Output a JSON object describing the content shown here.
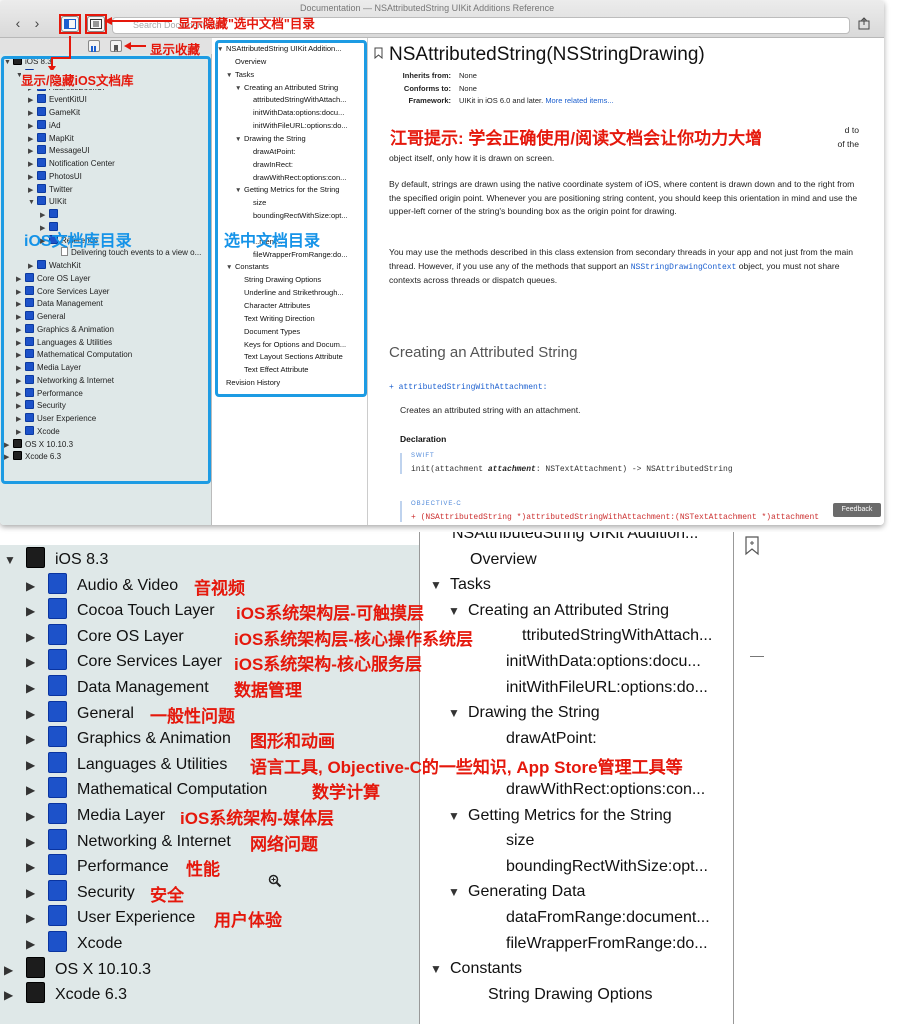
{
  "window": {
    "title": "Documentation — NSAttributedString UIKit Additions Reference",
    "search_placeholder": "Search Documentation"
  },
  "library": {
    "rows": [
      {
        "label": "iOS 8.3",
        "depth": 0,
        "open": true,
        "icon": "dark"
      },
      {
        "label": "Cocoa Touch Layer",
        "depth": 1,
        "open": true,
        "icon": "blue"
      },
      {
        "label": "AddressBookUI",
        "depth": 2,
        "open": false,
        "icon": "blue"
      },
      {
        "label": "EventKitUI",
        "depth": 2,
        "open": false,
        "icon": "blue"
      },
      {
        "label": "GameKit",
        "depth": 2,
        "open": false,
        "icon": "blue"
      },
      {
        "label": "iAd",
        "depth": 2,
        "open": false,
        "icon": "blue"
      },
      {
        "label": "MapKit",
        "depth": 2,
        "open": false,
        "icon": "blue"
      },
      {
        "label": "MessageUI",
        "depth": 2,
        "open": false,
        "icon": "blue"
      },
      {
        "label": "Notification Center",
        "depth": 2,
        "open": false,
        "icon": "blue"
      },
      {
        "label": "PhotosUI",
        "depth": 2,
        "open": false,
        "icon": "blue"
      },
      {
        "label": "Twitter",
        "depth": 2,
        "open": false,
        "icon": "blue"
      },
      {
        "label": "UIKit",
        "depth": 2,
        "open": true,
        "icon": "blue"
      },
      {
        "label": "",
        "depth": 3,
        "open": false,
        "icon": "blue"
      },
      {
        "label": "",
        "depth": 3,
        "open": false,
        "icon": "blue"
      },
      {
        "label": "Reference",
        "depth": 3,
        "open": false,
        "icon": "blue"
      },
      {
        "label": "Delivering touch events to a view o...",
        "depth": 4,
        "open": false,
        "icon": "doc"
      },
      {
        "label": "WatchKit",
        "depth": 2,
        "open": false,
        "icon": "blue"
      },
      {
        "label": "Core OS Layer",
        "depth": 1,
        "open": false,
        "icon": "blue"
      },
      {
        "label": "Core Services Layer",
        "depth": 1,
        "open": false,
        "icon": "blue"
      },
      {
        "label": "Data Management",
        "depth": 1,
        "open": false,
        "icon": "blue"
      },
      {
        "label": "General",
        "depth": 1,
        "open": false,
        "icon": "blue"
      },
      {
        "label": "Graphics & Animation",
        "depth": 1,
        "open": false,
        "icon": "blue"
      },
      {
        "label": "Languages & Utilities",
        "depth": 1,
        "open": false,
        "icon": "blue"
      },
      {
        "label": "Mathematical Computation",
        "depth": 1,
        "open": false,
        "icon": "blue"
      },
      {
        "label": "Media Layer",
        "depth": 1,
        "open": false,
        "icon": "blue"
      },
      {
        "label": "Networking & Internet",
        "depth": 1,
        "open": false,
        "icon": "blue"
      },
      {
        "label": "Performance",
        "depth": 1,
        "open": false,
        "icon": "blue"
      },
      {
        "label": "Security",
        "depth": 1,
        "open": false,
        "icon": "blue"
      },
      {
        "label": "User Experience",
        "depth": 1,
        "open": false,
        "icon": "blue"
      },
      {
        "label": "Xcode",
        "depth": 1,
        "open": false,
        "icon": "blue"
      },
      {
        "label": "OS X 10.10.3",
        "depth": 0,
        "open": false,
        "icon": "dark"
      },
      {
        "label": "Xcode 6.3",
        "depth": 0,
        "open": false,
        "icon": "dark"
      }
    ]
  },
  "toc": {
    "rows": [
      {
        "label": "NSAttributedString UIKit Addition...",
        "depth": 0,
        "tri": "open"
      },
      {
        "label": "Overview",
        "depth": 1,
        "tri": "none"
      },
      {
        "label": "Tasks",
        "depth": 1,
        "tri": "open"
      },
      {
        "label": "Creating an Attributed String",
        "depth": 2,
        "tri": "open"
      },
      {
        "label": "attributedStringWithAttach...",
        "depth": 3,
        "tri": "none"
      },
      {
        "label": "initWithData:options:docu...",
        "depth": 3,
        "tri": "none"
      },
      {
        "label": "initWithFileURL:options:do...",
        "depth": 3,
        "tri": "none"
      },
      {
        "label": "Drawing the String",
        "depth": 2,
        "tri": "open"
      },
      {
        "label": "drawAtPoint:",
        "depth": 3,
        "tri": "none"
      },
      {
        "label": "drawInRect:",
        "depth": 3,
        "tri": "none"
      },
      {
        "label": "drawWithRect:options:con...",
        "depth": 3,
        "tri": "none"
      },
      {
        "label": "Getting Metrics for the String",
        "depth": 2,
        "tri": "open"
      },
      {
        "label": "size",
        "depth": 3,
        "tri": "none"
      },
      {
        "label": "boundingRectWithSize:opt...",
        "depth": 3,
        "tri": "none"
      },
      {
        "label": "",
        "depth": 2,
        "tri": "none"
      },
      {
        "label": "...ment...",
        "depth": 3,
        "tri": "none"
      },
      {
        "label": "fileWrapperFromRange:do...",
        "depth": 3,
        "tri": "none"
      },
      {
        "label": "Constants",
        "depth": 1,
        "tri": "open"
      },
      {
        "label": "String Drawing Options",
        "depth": 2,
        "tri": "none"
      },
      {
        "label": "Underline and Strikethrough...",
        "depth": 2,
        "tri": "none"
      },
      {
        "label": "Character Attributes",
        "depth": 2,
        "tri": "none"
      },
      {
        "label": "Text Writing Direction",
        "depth": 2,
        "tri": "none"
      },
      {
        "label": "Document Types",
        "depth": 2,
        "tri": "none"
      },
      {
        "label": "Keys for Options and Docum...",
        "depth": 2,
        "tri": "none"
      },
      {
        "label": "Text Layout Sections Attribute",
        "depth": 2,
        "tri": "none"
      },
      {
        "label": "Text Effect Attribute",
        "depth": 2,
        "tri": "none"
      },
      {
        "label": "Revision History",
        "depth": 0,
        "tri": "none"
      }
    ]
  },
  "content": {
    "title": "NSAttributedString(NSStringDrawing)",
    "meta": [
      {
        "key": "Inherits from:",
        "value": "None",
        "link": ""
      },
      {
        "key": "Conforms to:",
        "value": "None",
        "link": ""
      },
      {
        "key": "Framework:",
        "value": "UIKit in iOS 6.0 and later.",
        "link": "More related items..."
      }
    ],
    "para1_visible": "object itself, only how it is drawn on screen.",
    "para1_right": "d to",
    "para1_right2": "of the",
    "para2": "By default, strings are drawn using the native coordinate system of iOS, where content is drawn down and to the right from the specified origin point. Whenever you are positioning string content, you should keep this orientation in mind and use the upper-left corner of the string's bounding box as the origin point for drawing.",
    "para3_a": "You may use the methods described in this class extension from secondary threads in your app and not just from the main thread. However, if you use any of the methods that support an",
    "para3_code": "NSStringDrawingContext",
    "para3_b": "object, you must not share contexts across threads or dispatch queues.",
    "section_heading": "Creating an Attributed String",
    "method_name": "+ attributedStringWithAttachment:",
    "method_desc": "Creates an attributed string with an attachment.",
    "decl_label": "Declaration",
    "swift_label": "SWIFT",
    "swift_code_a": "init(attachment ",
    "swift_code_param": "attachment",
    "swift_code_b": ": NSTextAttachment) -> NSAttributedString",
    "objc_label": "OBJECTIVE-C",
    "objc_code": "+ (NSAttributedString *)attributedStringWithAttachment:(NSTextAttachment *)attachment",
    "feedback": "Feedback"
  },
  "annotations": {
    "show_hide_selected_doc": "显示隐藏\"选中文档\"目录",
    "show_favorites": "显示收藏",
    "show_hide_ios_lib": "显示/隐藏iOS文档库",
    "tip": "江哥提示: 学会正确使用/阅读文档会让你功力大增",
    "ios_lib_dir": "iOS文档库目录",
    "selected_doc_dir": "选中文档目录"
  },
  "zoom": {
    "lib_rows": [
      {
        "label": "iOS 8.3",
        "depth": 0,
        "open": true,
        "icon": "dark",
        "note": ""
      },
      {
        "label": "Audio & Video",
        "depth": 1,
        "open": false,
        "icon": "blue",
        "note": "音视频"
      },
      {
        "label": "Cocoa Touch Layer",
        "depth": 1,
        "open": false,
        "icon": "blue",
        "note": "iOS系统架构层-可触摸层"
      },
      {
        "label": "Core OS Layer",
        "depth": 1,
        "open": false,
        "icon": "blue",
        "note": "iOS系统架构层-核心操作系统层"
      },
      {
        "label": "Core Services Layer",
        "depth": 1,
        "open": false,
        "icon": "blue",
        "note": "iOS系统架构-核心服务层"
      },
      {
        "label": "Data Management",
        "depth": 1,
        "open": false,
        "icon": "blue",
        "note": "数据管理"
      },
      {
        "label": "General",
        "depth": 1,
        "open": false,
        "icon": "blue",
        "note": "一般性问题"
      },
      {
        "label": "Graphics & Animation",
        "depth": 1,
        "open": false,
        "icon": "blue",
        "note": "图形和动画"
      },
      {
        "label": "Languages & Utilities",
        "depth": 1,
        "open": false,
        "icon": "blue",
        "note": "语言工具, Objective-C的一些知识, App Store管理工具等"
      },
      {
        "label": "Mathematical Computation",
        "depth": 1,
        "open": false,
        "icon": "blue",
        "note": "数学计算"
      },
      {
        "label": "Media Layer",
        "depth": 1,
        "open": false,
        "icon": "blue",
        "note": "iOS系统架构-媒体层"
      },
      {
        "label": "Networking & Internet",
        "depth": 1,
        "open": false,
        "icon": "blue",
        "note": "网络问题"
      },
      {
        "label": "Performance",
        "depth": 1,
        "open": false,
        "icon": "blue",
        "note": "性能"
      },
      {
        "label": "Security",
        "depth": 1,
        "open": false,
        "icon": "blue",
        "note": "安全"
      },
      {
        "label": "User Experience",
        "depth": 1,
        "open": false,
        "icon": "blue",
        "note": "用户体验"
      },
      {
        "label": "Xcode",
        "depth": 1,
        "open": false,
        "icon": "blue",
        "note": ""
      },
      {
        "label": "OS X 10.10.3",
        "depth": 0,
        "open": false,
        "icon": "dark",
        "note": ""
      },
      {
        "label": "Xcode 6.3",
        "depth": 0,
        "open": false,
        "icon": "dark",
        "note": ""
      }
    ],
    "toc_rows": [
      {
        "label": "NSAttributedString UIKit Addition...",
        "depth": 0,
        "tri": "none"
      },
      {
        "label": "Overview",
        "depth": 1,
        "tri": "none"
      },
      {
        "label": "Tasks",
        "depth": 1,
        "tri": "open"
      },
      {
        "label": "Creating an Attributed String",
        "depth": 2,
        "tri": "open"
      },
      {
        "label": "ttributedStringWithAttach...",
        "depth": 3,
        "tri": "none"
      },
      {
        "label": "initWithData:options:docu...",
        "depth": 3,
        "tri": "none"
      },
      {
        "label": "initWithFileURL:options:do...",
        "depth": 3,
        "tri": "none"
      },
      {
        "label": "Drawing the String",
        "depth": 2,
        "tri": "open"
      },
      {
        "label": "drawAtPoint:",
        "depth": 3,
        "tri": "none"
      },
      {
        "label": "",
        "depth": 3,
        "tri": "none"
      },
      {
        "label": "drawWithRect:options:con...",
        "depth": 3,
        "tri": "none"
      },
      {
        "label": "Getting Metrics for the String",
        "depth": 2,
        "tri": "open"
      },
      {
        "label": "size",
        "depth": 3,
        "tri": "none"
      },
      {
        "label": "boundingRectWithSize:opt...",
        "depth": 3,
        "tri": "none"
      },
      {
        "label": "Generating Data",
        "depth": 2,
        "tri": "open"
      },
      {
        "label": "dataFromRange:document...",
        "depth": 3,
        "tri": "none"
      },
      {
        "label": "fileWrapperFromRange:do...",
        "depth": 3,
        "tri": "none"
      },
      {
        "label": "Constants",
        "depth": 1,
        "tri": "open"
      },
      {
        "label": "String Drawing Options",
        "depth": 2,
        "tri": "none"
      }
    ]
  },
  "colors": {
    "annotation_red": "#e5180c",
    "annotation_blue": "#1593e8",
    "link_blue": "#1b5fcf",
    "sidebar_bg": "#dfe8e8"
  }
}
